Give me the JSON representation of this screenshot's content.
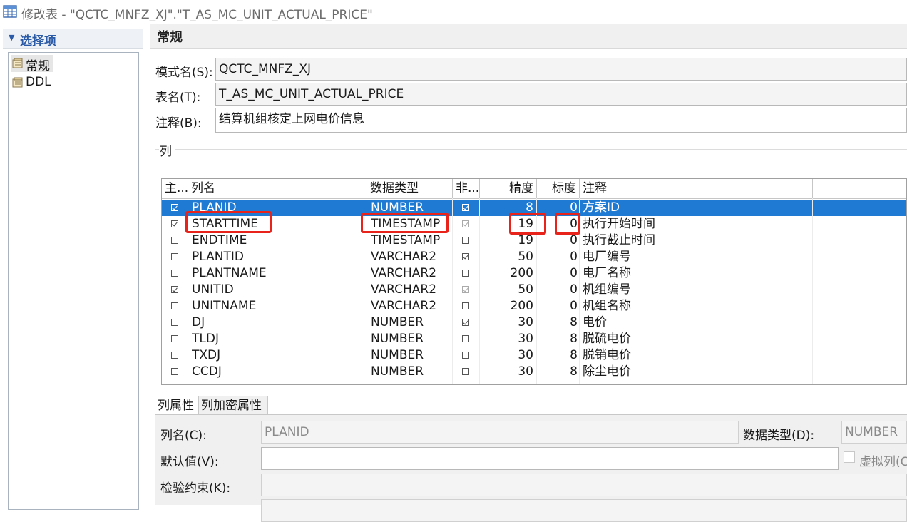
{
  "window": {
    "title": "修改表 - \"QCTC_MNFZ_XJ\".\"T_AS_MC_UNIT_ACTUAL_PRICE\"",
    "icon": "table-icon"
  },
  "left_panel": {
    "header": "选择项",
    "items": [
      {
        "label": "常规",
        "icon": "properties-icon",
        "selected": true
      },
      {
        "label": "DDL",
        "icon": "properties-icon",
        "selected": false
      }
    ]
  },
  "right_panel": {
    "header": "常规",
    "schema_label": "模式名(S):",
    "schema_value": "QCTC_MNFZ_XJ",
    "table_label": "表名(T):",
    "table_value": "T_AS_MC_UNIT_ACTUAL_PRICE",
    "comment_label": "注释(B):",
    "comment_value": "结算机组核定上网电价信息",
    "columns_group": "列"
  },
  "columns_table": {
    "headers": [
      "主...",
      "列名",
      "数据类型",
      "非...",
      "精度",
      "标度",
      "注释"
    ],
    "rows": [
      {
        "pk": true,
        "name": "PLANID",
        "type": "NUMBER",
        "notnull": true,
        "notnull_dim": false,
        "precision": "8",
        "scale": "0",
        "comment": "方案ID",
        "selected": true
      },
      {
        "pk": true,
        "name": "STARTTIME",
        "type": "TIMESTAMP",
        "notnull": true,
        "notnull_dim": true,
        "precision": "19",
        "scale": "0",
        "comment": "执行开始时间"
      },
      {
        "pk": false,
        "name": "ENDTIME",
        "type": "TIMESTAMP",
        "notnull": false,
        "notnull_dim": false,
        "precision": "19",
        "scale": "0",
        "comment": "执行截止时间"
      },
      {
        "pk": false,
        "name": "PLANTID",
        "type": "VARCHAR2",
        "notnull": true,
        "notnull_dim": false,
        "precision": "50",
        "scale": "0",
        "comment": "电厂编号"
      },
      {
        "pk": false,
        "name": "PLANTNAME",
        "type": "VARCHAR2",
        "notnull": false,
        "notnull_dim": false,
        "precision": "200",
        "scale": "0",
        "comment": "电厂名称"
      },
      {
        "pk": true,
        "name": "UNITID",
        "type": "VARCHAR2",
        "notnull": true,
        "notnull_dim": true,
        "precision": "50",
        "scale": "0",
        "comment": "机组编号"
      },
      {
        "pk": false,
        "name": "UNITNAME",
        "type": "VARCHAR2",
        "notnull": false,
        "notnull_dim": false,
        "precision": "200",
        "scale": "0",
        "comment": "机组名称"
      },
      {
        "pk": false,
        "name": "DJ",
        "type": "NUMBER",
        "notnull": true,
        "notnull_dim": false,
        "precision": "30",
        "scale": "8",
        "comment": "电价"
      },
      {
        "pk": false,
        "name": "TLDJ",
        "type": "NUMBER",
        "notnull": false,
        "notnull_dim": false,
        "precision": "30",
        "scale": "8",
        "comment": "脱硫电价"
      },
      {
        "pk": false,
        "name": "TXDJ",
        "type": "NUMBER",
        "notnull": false,
        "notnull_dim": false,
        "precision": "30",
        "scale": "8",
        "comment": "脱销电价"
      },
      {
        "pk": false,
        "name": "CCDJ",
        "type": "NUMBER",
        "notnull": false,
        "notnull_dim": false,
        "precision": "30",
        "scale": "8",
        "comment": "除尘电价"
      }
    ]
  },
  "bottom_tabs": [
    "列属性",
    "列加密属性"
  ],
  "column_props": {
    "name_label": "列名(C):",
    "name_value": "PLANID",
    "type_label": "数据类型(D):",
    "type_value": "NUMBER",
    "default_label": "默认值(V):",
    "default_value": "",
    "virtual_label": "虚拟列(C",
    "check_label": "检验约束(K):"
  },
  "colors": {
    "selection": "#1f7ad4",
    "highlight_box": "#e8231b",
    "header_accent": "#2b5aa6"
  }
}
